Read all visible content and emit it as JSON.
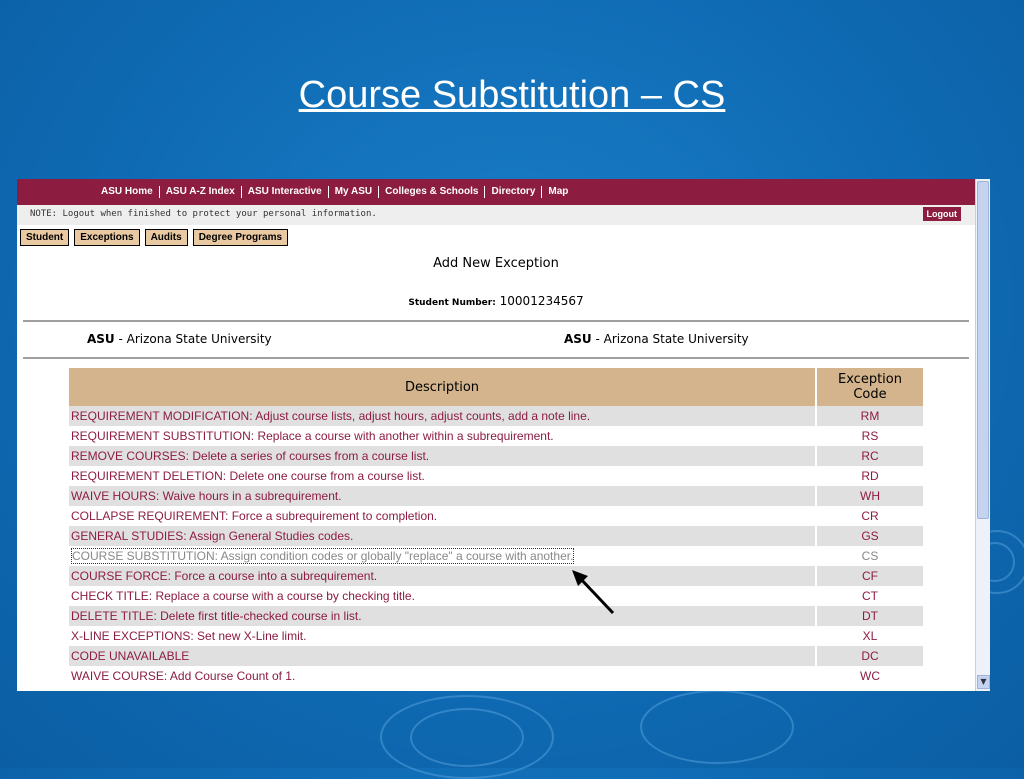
{
  "slide": {
    "title": "Course Substitution – CS"
  },
  "topnav": [
    "ASU Home",
    "ASU A-Z Index",
    "ASU Interactive",
    "My ASU",
    "Colleges & Schools",
    "Directory",
    "Map"
  ],
  "notebar": {
    "note": "NOTE: Logout when finished to protect your personal information.",
    "logout": "Logout"
  },
  "tabs": [
    "Student",
    "Exceptions",
    "Audits",
    "Degree Programs"
  ],
  "page": {
    "heading": "Add New Exception",
    "student_label": "Student Number:",
    "student_number": "10001234567"
  },
  "institutions": {
    "left_code": "ASU",
    "left_name": " - Arizona State University",
    "right_code": "ASU",
    "right_name": " - Arizona State University"
  },
  "table": {
    "headers": {
      "description": "Description",
      "code_line1": "Exception",
      "code_line2": "Code"
    },
    "rows": [
      {
        "description": "REQUIREMENT MODIFICATION: Adjust course lists, adjust hours, adjust counts, add a note line.",
        "code": "RM"
      },
      {
        "description": "REQUIREMENT SUBSTITUTION: Replace a course with another within a subrequirement.",
        "code": "RS"
      },
      {
        "description": "REMOVE COURSES: Delete a series of courses from a course list.",
        "code": "RC"
      },
      {
        "description": "REQUIREMENT DELETION: Delete one course from a course list.",
        "code": "RD"
      },
      {
        "description": "WAIVE HOURS: Waive hours in a subrequirement.",
        "code": "WH"
      },
      {
        "description": "COLLAPSE REQUIREMENT: Force a subrequirement to completion.",
        "code": "CR"
      },
      {
        "description": "GENERAL STUDIES: Assign General Studies codes.",
        "code": "GS"
      },
      {
        "description": "COURSE SUBSTITUTION: Assign condition codes or globally \"replace\" a course with another.",
        "code": "CS"
      },
      {
        "description": "COURSE FORCE: Force a course into a subrequirement.",
        "code": "CF"
      },
      {
        "description": "CHECK TITLE: Replace a course with a course by checking title.",
        "code": "CT"
      },
      {
        "description": "DELETE TITLE: Delete first title-checked course in list.",
        "code": "DT"
      },
      {
        "description": "X-LINE EXCEPTIONS: Set new X-Line limit.",
        "code": "XL"
      },
      {
        "description": "CODE UNAVAILABLE",
        "code": "DC"
      },
      {
        "description": "WAIVE COURSE: Add Course Count of 1.",
        "code": "WC"
      }
    ]
  },
  "colors": {
    "asu_maroon": "#8c1d40",
    "header_tan": "#d3b48c",
    "tab_tan": "#e9c9a1",
    "slide_blue": "#0f6bb4"
  },
  "icons": {
    "scroll_down": "chevron-down-icon",
    "pointer_arrow": "arrow-icon"
  }
}
